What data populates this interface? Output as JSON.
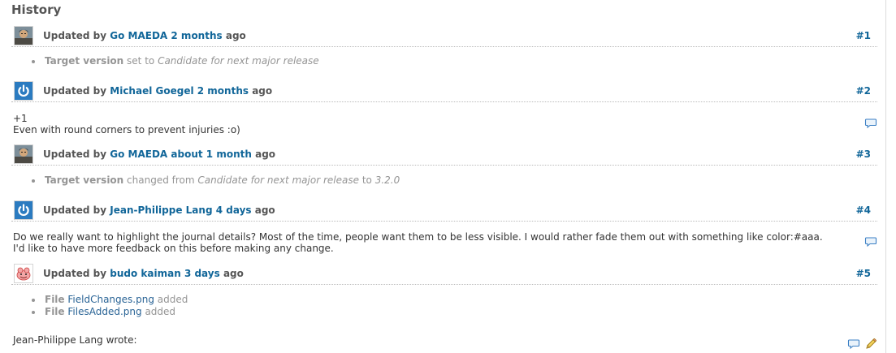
{
  "history_title": "History",
  "journals": [
    {
      "prefix": "Updated by",
      "author": "Go MAEDA",
      "time": "2 months",
      "suffix": "ago",
      "number": "#1",
      "avatar": "person-photo-icon",
      "details": [
        {
          "field": "Target version",
          "verb": "set to",
          "value": "Candidate for next major release"
        }
      ]
    },
    {
      "prefix": "Updated by",
      "author": "Michael Goegel",
      "time": "2 months",
      "suffix": "ago",
      "number": "#2",
      "avatar": "power-icon",
      "note_lines": [
        "+1",
        "Even with round corners to prevent injuries :o)"
      ]
    },
    {
      "prefix": "Updated by",
      "author": "Go MAEDA",
      "time": "about 1 month",
      "suffix": "ago",
      "number": "#3",
      "avatar": "person-photo-icon",
      "details": [
        {
          "field": "Target version",
          "verb": "changed from",
          "value": "Candidate for next major release",
          "verb2": "to",
          "value2": "3.2.0"
        }
      ]
    },
    {
      "prefix": "Updated by",
      "author": "Jean-Philippe Lang",
      "time": "4 days",
      "suffix": "ago",
      "number": "#4",
      "avatar": "power-icon",
      "note_lines": [
        "Do we really want to highlight the journal details? Most of the time, people want them to be less visible. I would rather fade them out with something like color:#aaa.",
        "I'd like to have more feedback on this before making any change."
      ]
    },
    {
      "prefix": "Updated by",
      "author": "budo kaiman",
      "time": "3 days",
      "suffix": "ago",
      "number": "#5",
      "avatar": "cartoon-character-icon",
      "details": [
        {
          "field": "File",
          "link": "FieldChanges.png",
          "verb": "added"
        },
        {
          "field": "File",
          "link": "FilesAdded.png",
          "verb": "added"
        }
      ],
      "note_lines": [
        "Jean-Philippe Lang wrote:"
      ]
    }
  ],
  "icons": {
    "quote": "speech-bubble-icon",
    "edit": "pencil-icon"
  },
  "colors": {
    "link": "#116699",
    "detail_gray": "#959595",
    "power_blue": "#2b7bc0"
  }
}
